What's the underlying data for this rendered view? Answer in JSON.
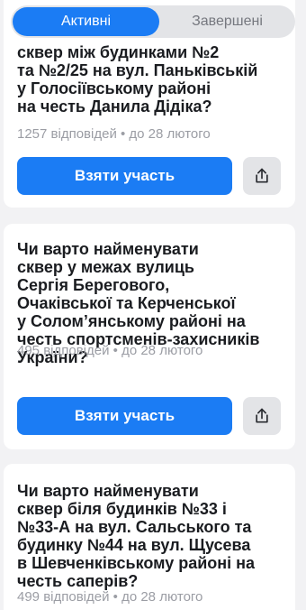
{
  "tabs": {
    "active": "Активні",
    "finished": "Завершені"
  },
  "polls": [
    {
      "question": "сквер між будинками №2\nта №2/25 на вул. Паньківській\nу Голосіївському районі\nна честь Данила Дідіка?",
      "meta": "1257 відповідей • до 28 лютого",
      "button": "Взяти участь"
    },
    {
      "question": "Чи варто найменувати\nсквер у межах вулиць\nСергія Берегового,\nОчаківської та Керченської\nу Солом’янському районі на\nчесть спортсменів-захисників\nУкраїни?",
      "meta": "495 відповідей • до 28 лютого",
      "button": "Взяти участь"
    },
    {
      "question": "Чи варто найменувати\nсквер біля будинків №33 і\n№33-А на вул. Сальського та\nбудинку №44 на вул. Щусева\nв Шевченківському районі на\nчесть саперів?",
      "meta": "499 відповідей • до 28 лютого"
    }
  ],
  "icons": {
    "share": "share-icon"
  },
  "colors": {
    "accent": "#1b7cf4",
    "background": "#f2f2f4"
  }
}
